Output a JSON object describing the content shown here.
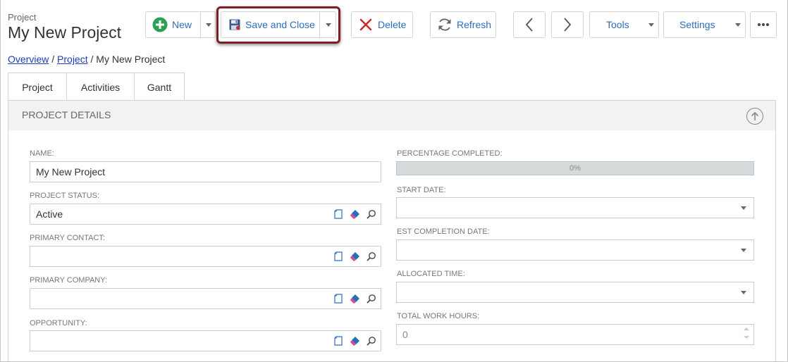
{
  "header": {
    "entity_label": "Project",
    "title": "My New Project"
  },
  "toolbar": {
    "new_label": "New",
    "save_close_label": "Save and Close",
    "delete_label": "Delete",
    "refresh_label": "Refresh",
    "tools_label": "Tools",
    "settings_label": "Settings"
  },
  "breadcrumb": {
    "items": [
      "Overview",
      "Project"
    ],
    "current": "My New Project",
    "separator": "/"
  },
  "tabs": [
    {
      "label": "Project",
      "active": true
    },
    {
      "label": "Activities",
      "active": false
    },
    {
      "label": "Gantt",
      "active": false
    }
  ],
  "section": {
    "title": "PROJECT DETAILS"
  },
  "fields_left": {
    "name": {
      "label": "NAME:",
      "value": "My New Project"
    },
    "status": {
      "label": "PROJECT STATUS:",
      "value": "Active"
    },
    "contact": {
      "label": "PRIMARY CONTACT:",
      "value": ""
    },
    "company": {
      "label": "PRIMARY COMPANY:",
      "value": ""
    },
    "opportunity": {
      "label": "OPPORTUNITY:",
      "value": ""
    }
  },
  "fields_right": {
    "percentage": {
      "label": "PERCENTAGE COMPLETED:",
      "value": "0%",
      "fraction": 0
    },
    "start_date": {
      "label": "START DATE:",
      "value": ""
    },
    "est_completion": {
      "label": "EST COMPLETION DATE:",
      "value": ""
    },
    "allocated_time": {
      "label": "ALLOCATED TIME:",
      "value": ""
    },
    "total_work_hours": {
      "label": "TOTAL WORK HOURS:",
      "value": "0"
    }
  },
  "colors": {
    "accent": "#2a6ebb",
    "highlight_box": "#7b1f24",
    "new_icon": "#2ea04f",
    "delete_icon": "#d0282e"
  }
}
